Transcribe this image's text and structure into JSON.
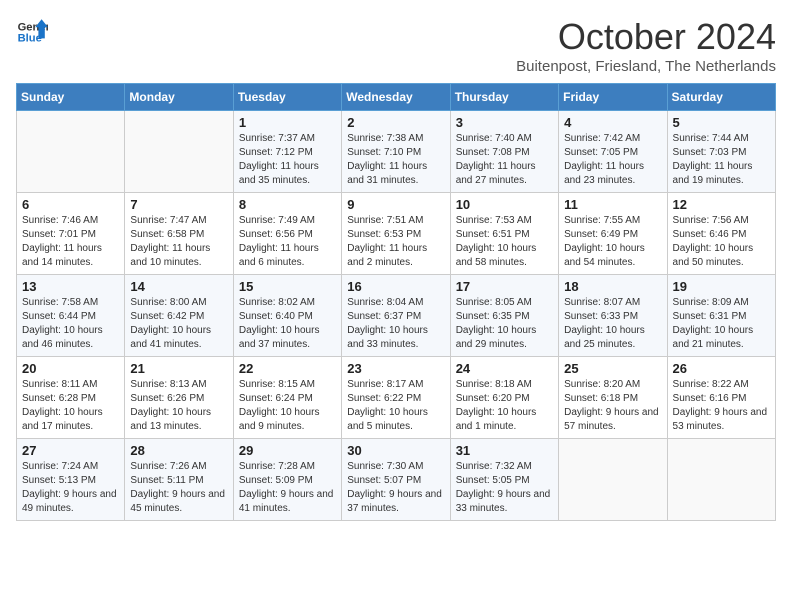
{
  "header": {
    "logo_line1": "General",
    "logo_line2": "Blue",
    "title": "October 2024",
    "location": "Buitenpost, Friesland, The Netherlands"
  },
  "columns": [
    "Sunday",
    "Monday",
    "Tuesday",
    "Wednesday",
    "Thursday",
    "Friday",
    "Saturday"
  ],
  "weeks": [
    [
      {
        "day": "",
        "info": ""
      },
      {
        "day": "",
        "info": ""
      },
      {
        "day": "1",
        "info": "Sunrise: 7:37 AM\nSunset: 7:12 PM\nDaylight: 11 hours and 35 minutes."
      },
      {
        "day": "2",
        "info": "Sunrise: 7:38 AM\nSunset: 7:10 PM\nDaylight: 11 hours and 31 minutes."
      },
      {
        "day": "3",
        "info": "Sunrise: 7:40 AM\nSunset: 7:08 PM\nDaylight: 11 hours and 27 minutes."
      },
      {
        "day": "4",
        "info": "Sunrise: 7:42 AM\nSunset: 7:05 PM\nDaylight: 11 hours and 23 minutes."
      },
      {
        "day": "5",
        "info": "Sunrise: 7:44 AM\nSunset: 7:03 PM\nDaylight: 11 hours and 19 minutes."
      }
    ],
    [
      {
        "day": "6",
        "info": "Sunrise: 7:46 AM\nSunset: 7:01 PM\nDaylight: 11 hours and 14 minutes."
      },
      {
        "day": "7",
        "info": "Sunrise: 7:47 AM\nSunset: 6:58 PM\nDaylight: 11 hours and 10 minutes."
      },
      {
        "day": "8",
        "info": "Sunrise: 7:49 AM\nSunset: 6:56 PM\nDaylight: 11 hours and 6 minutes."
      },
      {
        "day": "9",
        "info": "Sunrise: 7:51 AM\nSunset: 6:53 PM\nDaylight: 11 hours and 2 minutes."
      },
      {
        "day": "10",
        "info": "Sunrise: 7:53 AM\nSunset: 6:51 PM\nDaylight: 10 hours and 58 minutes."
      },
      {
        "day": "11",
        "info": "Sunrise: 7:55 AM\nSunset: 6:49 PM\nDaylight: 10 hours and 54 minutes."
      },
      {
        "day": "12",
        "info": "Sunrise: 7:56 AM\nSunset: 6:46 PM\nDaylight: 10 hours and 50 minutes."
      }
    ],
    [
      {
        "day": "13",
        "info": "Sunrise: 7:58 AM\nSunset: 6:44 PM\nDaylight: 10 hours and 46 minutes."
      },
      {
        "day": "14",
        "info": "Sunrise: 8:00 AM\nSunset: 6:42 PM\nDaylight: 10 hours and 41 minutes."
      },
      {
        "day": "15",
        "info": "Sunrise: 8:02 AM\nSunset: 6:40 PM\nDaylight: 10 hours and 37 minutes."
      },
      {
        "day": "16",
        "info": "Sunrise: 8:04 AM\nSunset: 6:37 PM\nDaylight: 10 hours and 33 minutes."
      },
      {
        "day": "17",
        "info": "Sunrise: 8:05 AM\nSunset: 6:35 PM\nDaylight: 10 hours and 29 minutes."
      },
      {
        "day": "18",
        "info": "Sunrise: 8:07 AM\nSunset: 6:33 PM\nDaylight: 10 hours and 25 minutes."
      },
      {
        "day": "19",
        "info": "Sunrise: 8:09 AM\nSunset: 6:31 PM\nDaylight: 10 hours and 21 minutes."
      }
    ],
    [
      {
        "day": "20",
        "info": "Sunrise: 8:11 AM\nSunset: 6:28 PM\nDaylight: 10 hours and 17 minutes."
      },
      {
        "day": "21",
        "info": "Sunrise: 8:13 AM\nSunset: 6:26 PM\nDaylight: 10 hours and 13 minutes."
      },
      {
        "day": "22",
        "info": "Sunrise: 8:15 AM\nSunset: 6:24 PM\nDaylight: 10 hours and 9 minutes."
      },
      {
        "day": "23",
        "info": "Sunrise: 8:17 AM\nSunset: 6:22 PM\nDaylight: 10 hours and 5 minutes."
      },
      {
        "day": "24",
        "info": "Sunrise: 8:18 AM\nSunset: 6:20 PM\nDaylight: 10 hours and 1 minute."
      },
      {
        "day": "25",
        "info": "Sunrise: 8:20 AM\nSunset: 6:18 PM\nDaylight: 9 hours and 57 minutes."
      },
      {
        "day": "26",
        "info": "Sunrise: 8:22 AM\nSunset: 6:16 PM\nDaylight: 9 hours and 53 minutes."
      }
    ],
    [
      {
        "day": "27",
        "info": "Sunrise: 7:24 AM\nSunset: 5:13 PM\nDaylight: 9 hours and 49 minutes."
      },
      {
        "day": "28",
        "info": "Sunrise: 7:26 AM\nSunset: 5:11 PM\nDaylight: 9 hours and 45 minutes."
      },
      {
        "day": "29",
        "info": "Sunrise: 7:28 AM\nSunset: 5:09 PM\nDaylight: 9 hours and 41 minutes."
      },
      {
        "day": "30",
        "info": "Sunrise: 7:30 AM\nSunset: 5:07 PM\nDaylight: 9 hours and 37 minutes."
      },
      {
        "day": "31",
        "info": "Sunrise: 7:32 AM\nSunset: 5:05 PM\nDaylight: 9 hours and 33 minutes."
      },
      {
        "day": "",
        "info": ""
      },
      {
        "day": "",
        "info": ""
      }
    ]
  ]
}
